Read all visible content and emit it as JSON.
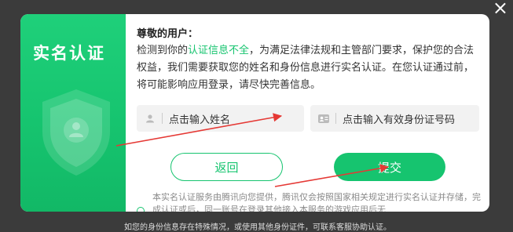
{
  "close_icon": "×",
  "left_panel": {
    "title": "实名认证",
    "shield_icon": "shield-user-icon"
  },
  "greeting": "尊敬的用户：",
  "description": {
    "part1": "检测到你的",
    "highlight": "认证信息不全",
    "part2": "，为满足法律法规和主管部门要求，保护您的合法权益，我们需要获取您的姓名和身份信息进行实名认证。在您认证通过前，将可能影响应用登录，请尽快完善信息。"
  },
  "inputs": {
    "name_placeholder": "点击输入姓名",
    "id_placeholder": "点击输入有效身份证号码"
  },
  "buttons": {
    "back": "返回",
    "submit": "提交"
  },
  "notice": "本实名认证服务由腾讯向您提供，腾讯仅会按照国家相关规定进行实名认证并存储，完成认证或后，同一账号在登录其他接入本服务的游戏应用后无",
  "below_text": "如您的身份信息存在特殊情况，或使用其他身份证件，可联系客服协助认证。",
  "colors": {
    "accent": "#16c46f",
    "overlay": "#3b3b3b",
    "annotation": "#e53935"
  }
}
